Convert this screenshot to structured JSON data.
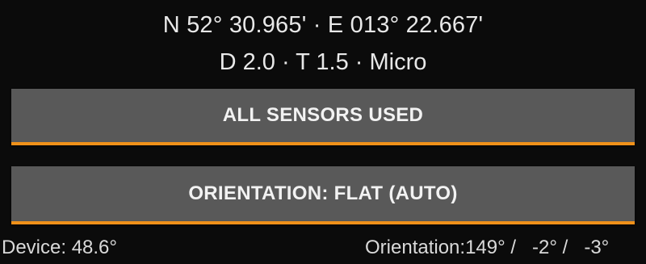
{
  "header": {
    "coordinates": "N 52° 30.965' · E 013° 22.667'",
    "cache_info": "D 2.0 · T 1.5 · Micro"
  },
  "buttons": {
    "sensors_label": "ALL SENSORS USED",
    "orientation_label": "ORIENTATION: FLAT (AUTO)"
  },
  "status": {
    "device": "Device:  48.6°",
    "orientation": "Orientation:149° /   -2° /   -3°"
  },
  "colors": {
    "background": "#0b0b0b",
    "button_background": "#595959",
    "button_underline": "#f0911a",
    "text": "#e6e6e6"
  }
}
